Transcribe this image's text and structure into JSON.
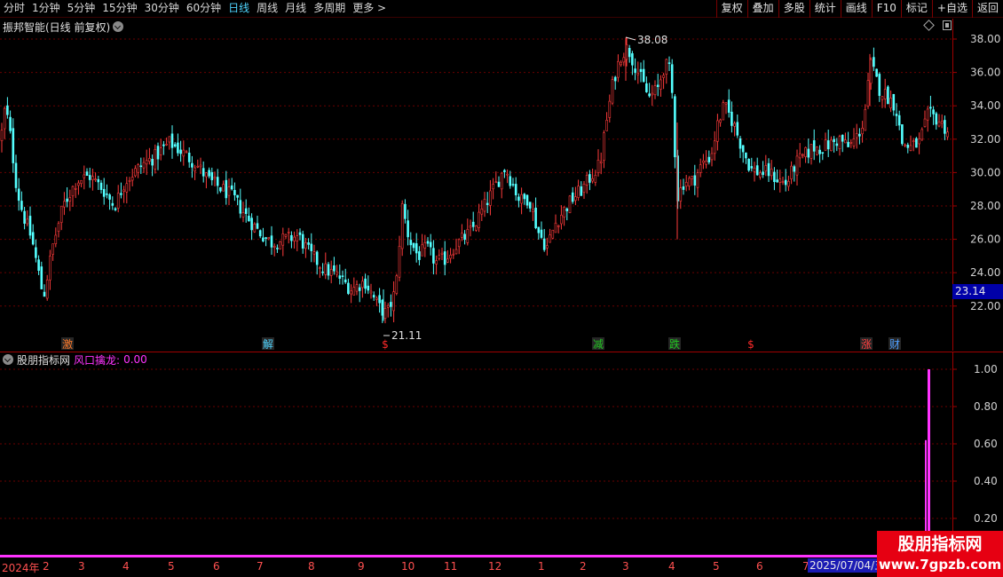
{
  "toolbar": {
    "period_tabs": [
      "分时",
      "1分钟",
      "5分钟",
      "15分钟",
      "30分钟",
      "60分钟",
      "日线",
      "周线",
      "月线",
      "多周期",
      "更多 >"
    ],
    "active_tab": "日线",
    "buttons": [
      "复权",
      "叠加",
      "多股",
      "统计",
      "画线",
      "F10",
      "标记",
      "+自选",
      "返回"
    ]
  },
  "main_chart": {
    "title": "振邦智能(日线 前复权)",
    "price_high_label": "38.08",
    "price_low_label": "21.11",
    "current_price": "23.14",
    "event_marks": [
      {
        "label": "激",
        "color": "#ff7a2a"
      },
      {
        "label": "解",
        "color": "#4fd5ff"
      },
      {
        "label": "$",
        "color": "#ff2a2a"
      },
      {
        "label": "减",
        "color": "#22c822"
      },
      {
        "label": "跌",
        "color": "#22c822"
      },
      {
        "label": "$",
        "color": "#ff2a2a"
      },
      {
        "label": "涨",
        "color": "#ff4040"
      },
      {
        "label": "财",
        "color": "#4f9fff"
      }
    ]
  },
  "indicator": {
    "name": "股朋指标网",
    "series_label": "风口擒龙:",
    "series_value": "0.00"
  },
  "date_axis": {
    "year_label": "2024年",
    "months": [
      "2",
      "3",
      "4",
      "5",
      "6",
      "7",
      "8",
      "9",
      "10",
      "11",
      "12",
      "1",
      "2",
      "3",
      "4",
      "5",
      "6",
      "7"
    ],
    "current_date": "2025/07/04/五"
  },
  "chart_data": [
    {
      "type": "candlestick",
      "title": "振邦智能(日线 前复权)",
      "ylim": [
        21,
        38.5
      ],
      "y_ticks": [
        22,
        24,
        26,
        28,
        30,
        32,
        34,
        36,
        38
      ],
      "high": 38.08,
      "low": 21.11,
      "last": 23.14,
      "close_path": [
        [
          0,
          32.0
        ],
        [
          5,
          34.0
        ],
        [
          10,
          32.5
        ],
        [
          18,
          29.0
        ],
        [
          25,
          27.5
        ],
        [
          35,
          26.0
        ],
        [
          48,
          22.5
        ],
        [
          58,
          25.5
        ],
        [
          70,
          28.0
        ],
        [
          85,
          29.5
        ],
        [
          100,
          29.8
        ],
        [
          115,
          29.0
        ],
        [
          128,
          28.0
        ],
        [
          140,
          29.5
        ],
        [
          150,
          30.0
        ],
        [
          160,
          30.5
        ],
        [
          175,
          31.0
        ],
        [
          190,
          31.8
        ],
        [
          205,
          31.2
        ],
        [
          220,
          30.5
        ],
        [
          235,
          29.5
        ],
        [
          250,
          29.0
        ],
        [
          262,
          28.5
        ],
        [
          275,
          27.5
        ],
        [
          290,
          26.5
        ],
        [
          305,
          25.8
        ],
        [
          320,
          26.0
        ],
        [
          335,
          26.2
        ],
        [
          350,
          25.0
        ],
        [
          365,
          24.2
        ],
        [
          380,
          23.8
        ],
        [
          395,
          23.0
        ],
        [
          410,
          23.5
        ],
        [
          425,
          22.0
        ],
        [
          435,
          21.5
        ],
        [
          445,
          23.0
        ],
        [
          452,
          28.0
        ],
        [
          460,
          26.0
        ],
        [
          470,
          25.0
        ],
        [
          480,
          25.5
        ],
        [
          490,
          24.6
        ],
        [
          500,
          24.8
        ],
        [
          510,
          25.5
        ],
        [
          520,
          26.0
        ],
        [
          530,
          26.5
        ],
        [
          540,
          27.5
        ],
        [
          550,
          28.5
        ],
        [
          560,
          29.5
        ],
        [
          568,
          30.3
        ],
        [
          575,
          29.5
        ],
        [
          585,
          28.3
        ],
        [
          595,
          28.5
        ],
        [
          605,
          26.5
        ],
        [
          615,
          25.5
        ],
        [
          625,
          27.0
        ],
        [
          635,
          27.8
        ],
        [
          645,
          28.5
        ],
        [
          655,
          29.0
        ],
        [
          665,
          29.8
        ],
        [
          675,
          30.5
        ],
        [
          682,
          33.0
        ],
        [
          690,
          35.5
        ],
        [
          698,
          37.0
        ],
        [
          706,
          37.5
        ],
        [
          714,
          36.5
        ],
        [
          722,
          35.5
        ],
        [
          730,
          34.5
        ],
        [
          740,
          35.0
        ],
        [
          748,
          36.5
        ],
        [
          755,
          36.0
        ],
        [
          762,
          28.5
        ],
        [
          770,
          29.5
        ],
        [
          780,
          29.5
        ],
        [
          790,
          30.5
        ],
        [
          800,
          31.0
        ],
        [
          808,
          33.0
        ],
        [
          815,
          34.0
        ],
        [
          825,
          33.0
        ],
        [
          835,
          31.5
        ],
        [
          845,
          30.2
        ],
        [
          855,
          30.0
        ],
        [
          865,
          30.0
        ],
        [
          875,
          29.6
        ],
        [
          885,
          29.3
        ],
        [
          895,
          30.5
        ],
        [
          905,
          31.0
        ],
        [
          915,
          31.5
        ],
        [
          925,
          31.5
        ],
        [
          935,
          31.7
        ],
        [
          945,
          32.0
        ],
        [
          955,
          31.5
        ],
        [
          965,
          32.2
        ],
        [
          972,
          33.0
        ],
        [
          980,
          36.5
        ],
        [
          990,
          35.0
        ],
        [
          1000,
          34.5
        ],
        [
          1008,
          34.0
        ],
        [
          1015,
          31.8
        ],
        [
          1025,
          31.5
        ],
        [
          1035,
          31.8
        ],
        [
          1045,
          33.5
        ],
        [
          1055,
          33.2
        ],
        [
          1067,
          32.5
        ]
      ]
    },
    {
      "type": "bar",
      "title": "股朋指标网",
      "series": [
        {
          "name": "风口擒龙",
          "last_value": 0.0
        }
      ],
      "ylim": [
        0,
        1.05
      ],
      "y_ticks": [
        0.2,
        0.4,
        0.6,
        0.8,
        1.0
      ],
      "signal": {
        "value": 1.0,
        "at_month_index": 17
      }
    }
  ]
}
